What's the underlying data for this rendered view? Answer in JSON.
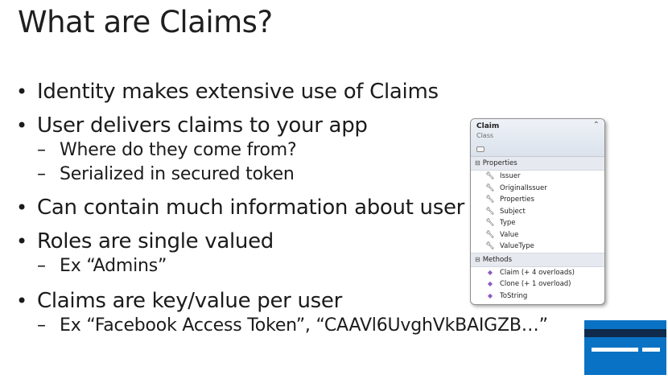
{
  "slide": {
    "title": "What are Claims?"
  },
  "bullets": [
    {
      "text": "Identity makes extensive use of Claims",
      "subitems": []
    },
    {
      "text": "User delivers claims to your app",
      "subitems": [
        "Where do they come from?",
        "Serialized in secured token"
      ]
    },
    {
      "text": "Can contain much information about user",
      "subitems": []
    },
    {
      "text": "Roles are single valued",
      "subitems": [
        "Ex “Admins”"
      ]
    },
    {
      "text": "Claims are key/value per user",
      "subitems": [
        "Ex “Facebook Access Token”, “CAAVl6UvghVkBAIGZB…”"
      ]
    }
  ],
  "class_diagram": {
    "name": "Claim",
    "kind": "Class",
    "collapse_icon": "double-chevron-up-icon",
    "properties_label": "Properties",
    "properties": [
      "Issuer",
      "OriginalIssuer",
      "Properties",
      "Subject",
      "Type",
      "Value",
      "ValueType"
    ],
    "methods_label": "Methods",
    "methods": [
      "Claim (+ 4 overloads)",
      "Clone (+ 1 overload)",
      "ToString"
    ],
    "property_icon": "wrench-icon",
    "method_icon": "method-cube-icon",
    "toggle_icon": "minus-box-icon"
  },
  "colors": {
    "card_blue": "#0a72c4",
    "card_stripe": "#0f2a4a",
    "method_purple": "#8a5bc2"
  }
}
